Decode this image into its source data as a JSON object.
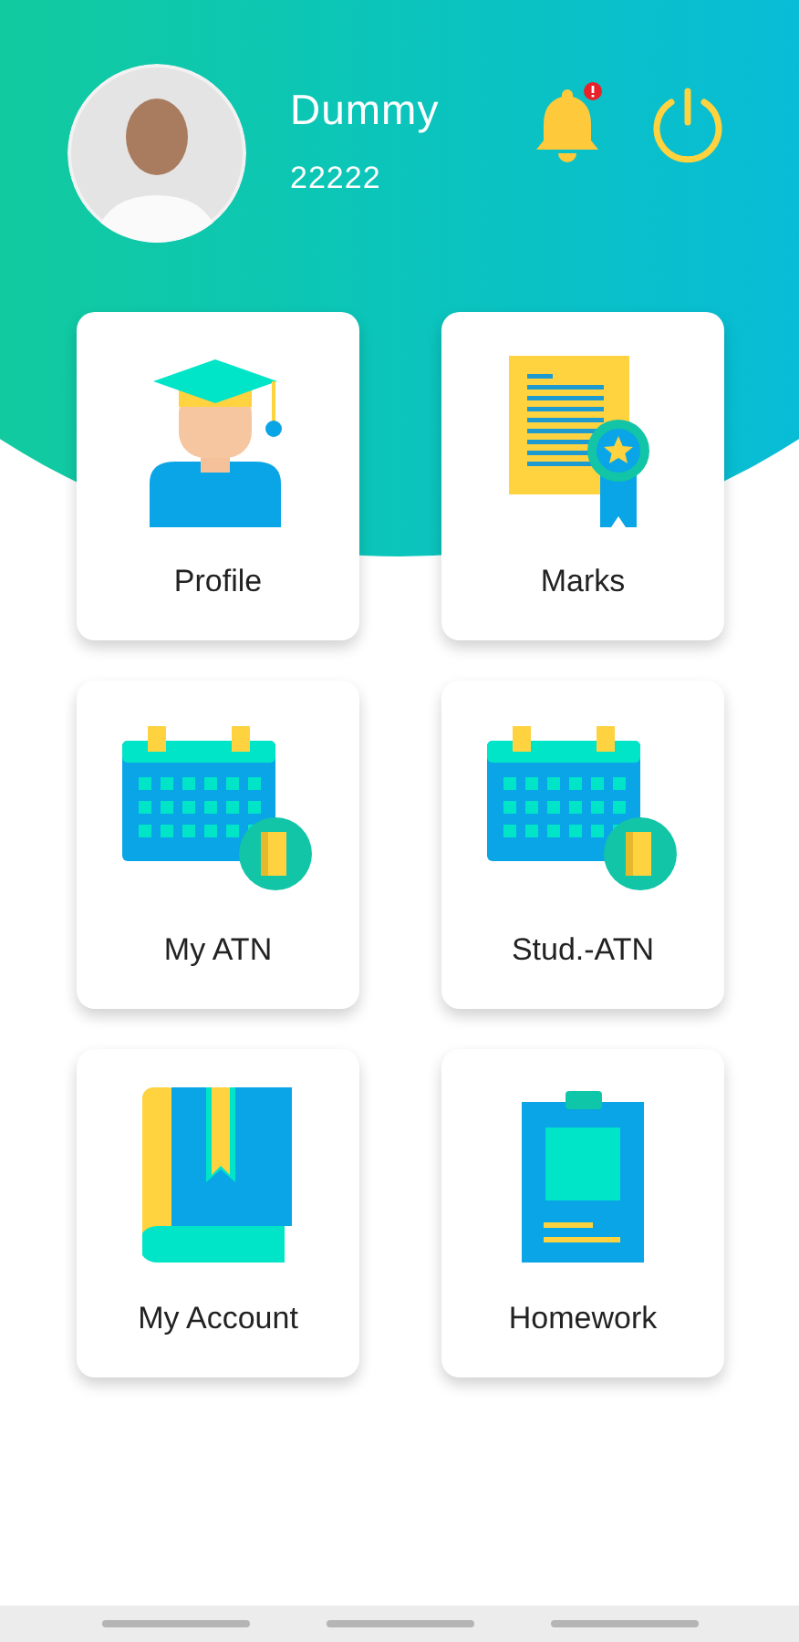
{
  "header": {
    "name": "Dummy",
    "id_number": "22222",
    "has_notification": true
  },
  "tiles": [
    {
      "label": "Profile",
      "kind": "graduate"
    },
    {
      "label": "Marks",
      "kind": "certificate"
    },
    {
      "label": "My ATN",
      "kind": "calendar"
    },
    {
      "label": "Stud.-ATN",
      "kind": "calendar"
    },
    {
      "label": "My Account",
      "kind": "book"
    },
    {
      "label": "Homework",
      "kind": "clipboard"
    }
  ]
}
